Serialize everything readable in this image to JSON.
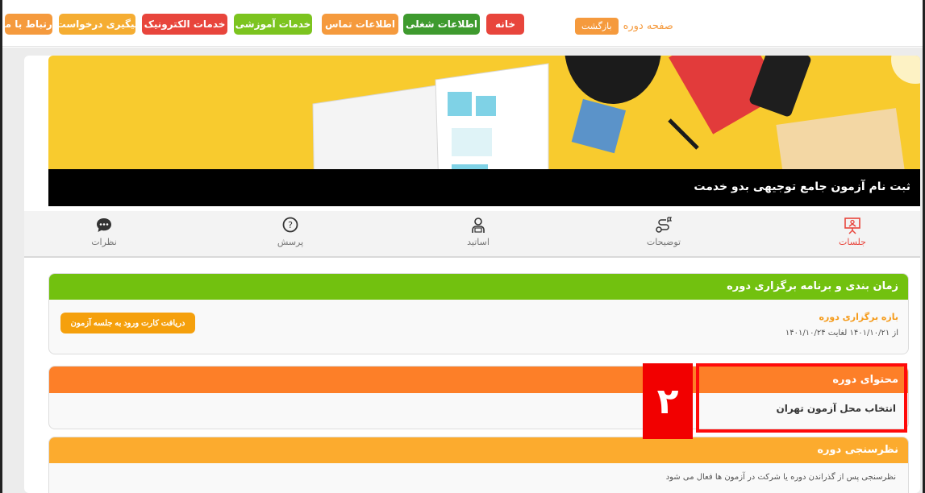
{
  "topnav": {
    "page_title": "صفحه دوره",
    "back_label": "بازگشت",
    "buttons": [
      {
        "label": "ارتباط با ما",
        "color": "#f59a3d"
      },
      {
        "label": "پیگیری درخواست",
        "color": "#f5ad32"
      },
      {
        "label": "خدمات الکترونیک",
        "color": "#e8453c"
      },
      {
        "label": "خدمات آموزشی",
        "color": "#7cc41f"
      },
      {
        "label": "اطلاعات تماس",
        "color": "#f59a3d"
      },
      {
        "label": "اطلاعات شغلی",
        "color": "#3e9a2e"
      },
      {
        "label": "خانه",
        "color": "#e8453c"
      }
    ]
  },
  "banner": {
    "caption": "ثبت نام آزمون جامع توجیهی بدو خدمت"
  },
  "tabs": [
    {
      "label": "نظرات",
      "icon": "comment-icon"
    },
    {
      "label": "پرسش",
      "icon": "question-icon"
    },
    {
      "label": "اساتید",
      "icon": "teacher-icon"
    },
    {
      "label": "توضیحات",
      "icon": "route-icon"
    },
    {
      "label": "جلسات",
      "icon": "presentation-icon",
      "active": true
    }
  ],
  "schedule": {
    "title": "زمان بندی و برنامه برگزاری دوره",
    "range_label": "بازه برگزاری دوره",
    "range_value": "از ۱۴۰۱/۱۰/۲۱ لغایت ۱۴۰۱/۱۰/۲۴",
    "card_button": "دریافت کارت ورود به جلسه آزمون",
    "color": "#72c10f"
  },
  "content": {
    "title": "محتوای دوره",
    "item": "انتخاب محل آزمون تهران",
    "color": "#fd7f28"
  },
  "survey": {
    "title": "نظرسنجی دوره",
    "text": "نظرسنجی پس از گذراندن دوره یا شرکت در آزمون ها فعال می شود",
    "color": "#fcab2e"
  },
  "annotation": {
    "number": "۲",
    "color": "#f20000"
  }
}
